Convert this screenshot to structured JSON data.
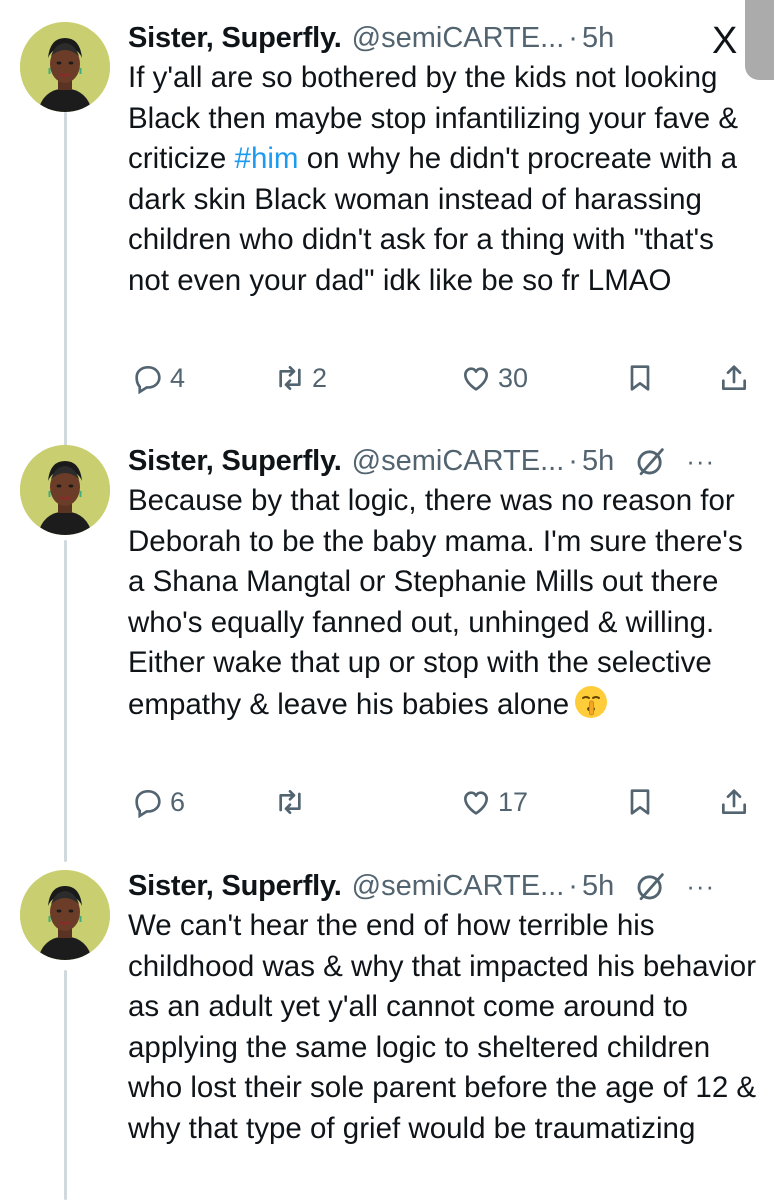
{
  "tweets": [
    {
      "name": "Sister, Superfly.",
      "handle": "@semiCARTE...",
      "separator": "·",
      "time": "5h",
      "text_pre": "If y'all are so bothered by the kids not looking Black then maybe stop infantilizing your fave & criticize ",
      "hashtag": "#him",
      "text_post": " on why he didn't procreate with a dark skin Black woman instead of harassing children who didn't ask for a thing with \"that's not even your dad\" idk like be so fr LMAO",
      "replies": "4",
      "reposts": "2",
      "likes": "30"
    },
    {
      "name": "Sister, Superfly.",
      "handle": "@semiCARTE...",
      "separator": "·",
      "time": "5h",
      "more": "···",
      "text": "Because by that logic, there was no reason for Deborah to be the baby mama. I'm sure there's a Shana Mangtal or Stephanie Mills out there who's equally fanned out, unhinged & willing. Either wake that up or stop with the selective empathy & leave his babies alone",
      "emoji": "shushing-face-emoji",
      "replies": "6",
      "reposts": "",
      "likes": "17"
    },
    {
      "name": "Sister, Superfly.",
      "handle": "@semiCARTE...",
      "separator": "·",
      "time": "5h",
      "more": "···",
      "text": "We can't hear the end of how terrible his childhood was & why that impacted his behavior as an adult yet y'all cannot come around to applying the same logic to sheltered children who lost their sole parent before the age of 12 & why that type of grief would be traumatizing"
    }
  ],
  "close_glyph": "X",
  "colors": {
    "accent": "#1d9bf0",
    "text": "#0f1419",
    "muted": "#536471",
    "avatar_bg": "#c9cf70"
  }
}
